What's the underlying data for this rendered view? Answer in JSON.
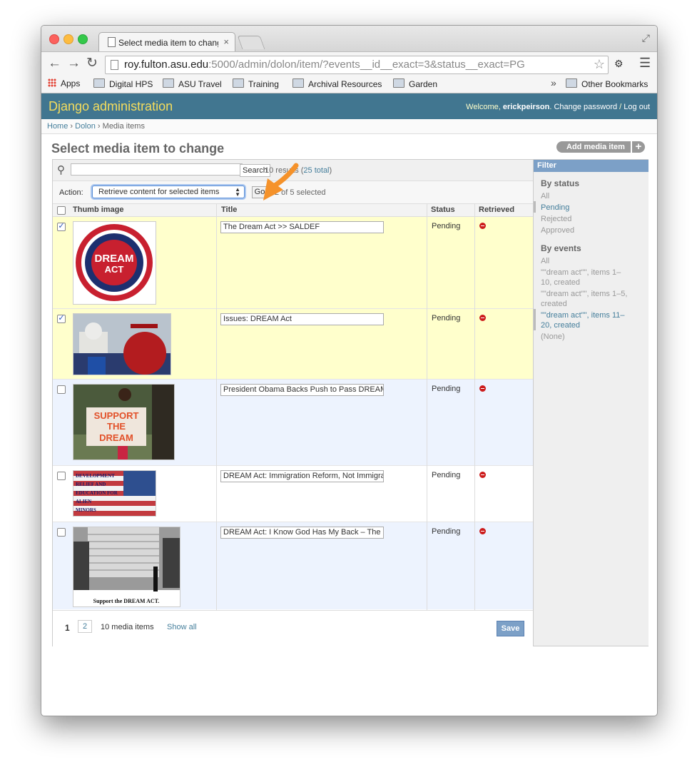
{
  "browser": {
    "tab_title": "Select media item to change",
    "tab_close": "×",
    "url_host": "roy.fulton.asu.edu",
    "url_rest": ":5000/admin/dolon/item/?events__id__exact=3&status__exact=PG",
    "bookmarks": [
      "Apps",
      "Digital HPS",
      "ASU Travel",
      "Training",
      "Archival Resources",
      "Garden"
    ],
    "bookmarks_overflow": "»",
    "other_bookmarks": "Other Bookmarks"
  },
  "admin": {
    "site_title": "Django administration",
    "welcome": "Welcome, ",
    "username": "erickpeirson",
    "change_password": "Change password",
    "separator": " / ",
    "logout": "Log out"
  },
  "breadcrumbs": [
    "Home",
    "Dolon",
    "Media items"
  ],
  "breadcrumb_sep": " › ",
  "page": {
    "title": "Select media item to change",
    "add_button": "Add media item",
    "add_plus": "+"
  },
  "search": {
    "placeholder": "",
    "button": "Search",
    "results_count": "10 results (",
    "results_total": "25 total",
    "results_close": ")"
  },
  "actions": {
    "label": "Action:",
    "selected_action": "Retrieve content for selected items",
    "go": "Go",
    "selection_count": "2 of 5 selected"
  },
  "table": {
    "columns": [
      "Thumb image",
      "Title",
      "Status",
      "Retrieved"
    ],
    "rows": [
      {
        "checked": true,
        "title": "The Dream Act >> SALDEF",
        "status": "Pending",
        "thumb": "dream-act-seal"
      },
      {
        "checked": true,
        "title": "Issues: DREAM Act",
        "status": "Pending",
        "thumb": "capitol-graduate"
      },
      {
        "checked": false,
        "title": "President Obama Backs Push to Pass DREAM Act",
        "status": "Pending",
        "thumb": "support-the-dream-sign"
      },
      {
        "checked": false,
        "title": "DREAM Act: Immigration Reform, Not Immigration",
        "status": "Pending",
        "thumb": "development-relief-flag"
      },
      {
        "checked": false,
        "title": "DREAM Act: I Know God Has My Back – The",
        "status": "Pending",
        "thumb": "support-the-dream-act-building"
      }
    ],
    "thumb_texts": {
      "seal_line1": "DREAM",
      "seal_line2": "ACT",
      "sign_line1": "SUPPORT",
      "sign_line2": "THE",
      "sign_line3": "DREAM",
      "flag_lines": [
        "DEVELOPMENT",
        "RELIEF AND",
        "EDUCATION FOR",
        "ALIEN",
        "MINORS"
      ],
      "building_caption": "Support the DREAM ACT."
    }
  },
  "pagination": {
    "current": "1",
    "next": "2",
    "count": "10 media items",
    "show_all": "Show all",
    "save": "Save"
  },
  "filter": {
    "header": "Filter",
    "by_status": "By status",
    "status_items": [
      "All",
      "Pending",
      "Rejected",
      "Approved"
    ],
    "status_active": "Pending",
    "by_events": "By events",
    "event_items": [
      "All",
      "\"\"dream act\"\", items 1–",
      "10, created",
      "\"\"dream act\"\", items 1–5,",
      "created",
      "\"\"dream act\"\", items 11–",
      "20, created",
      "(None)"
    ]
  },
  "colors": {
    "header_bg": "#417690",
    "site_title": "#f5dd5d",
    "selected_row": "#ffffcc",
    "alt_row": "#edf3fe",
    "link": "#447e9b",
    "annotation_arrow": "#f5922a"
  }
}
